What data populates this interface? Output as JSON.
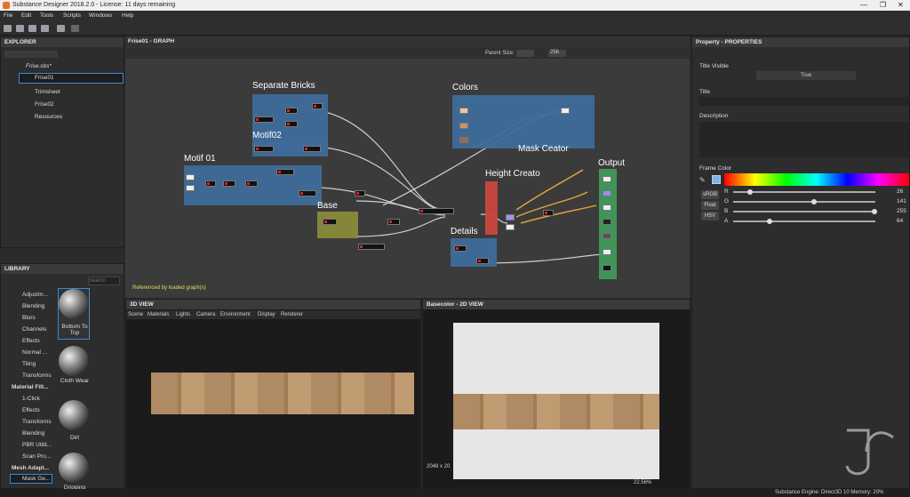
{
  "window": {
    "title": "Substance Designer 2018.2.0 - License: 11 days remaining"
  },
  "menu": [
    "File",
    "Edit",
    "Tools",
    "Scripts",
    "Windows",
    "Help"
  ],
  "explorer": {
    "title": "EXPLORER",
    "package": "Frise.sbs*",
    "items": [
      "Frise01",
      "Trimsheet",
      "Frise02",
      "Resources"
    ]
  },
  "library": {
    "title": "LIBRARY",
    "search_placeholder": "Search",
    "categories": [
      "Adjustm...",
      "Blending",
      "Blurs",
      "Channels",
      "Effects",
      "Normal ...",
      "Tiling",
      "Transforms"
    ],
    "material_header": "Material Filt...",
    "material_items": [
      "1-Click",
      "Effects",
      "Transforms",
      "Blending",
      "PBR Utilit...",
      "Scan Pro..."
    ],
    "mesh_header": "Mesh Adapt...",
    "mesh_items": [
      "Mask Ge..."
    ],
    "thumbs": [
      "Bottom To Top",
      "Cloth Wear",
      "Dirt",
      "Dripping"
    ]
  },
  "graph": {
    "title": "Frise01 - GRAPH",
    "parent_size_label": "Parent Size:",
    "parent_size_value": "256",
    "frames": [
      "Separate Bricks",
      "Motif02",
      "Motif 01",
      "Colors",
      "Mask Ceator",
      "Height Creato",
      "Base",
      "Details",
      "Output"
    ],
    "footer": "Referenced by loaded graph(s)"
  },
  "view3d": {
    "title": "3D VIEW",
    "menu": [
      "Scene",
      "Materials",
      "Lights",
      "Camera",
      "Environment",
      "Display",
      "Renderer"
    ]
  },
  "view2d": {
    "title": "Basecolor - 2D VIEW",
    "resolution": "2048 x 20",
    "zoom": "22.56%"
  },
  "properties": {
    "title": "Property - PROPERTIES",
    "title_visible_label": "Title Visible",
    "title_visible_value": "True",
    "title_label": "Title",
    "description_label": "Description",
    "frame_color_label": "Frame Color",
    "mode_buttons": [
      "sRGB",
      "Float",
      "HSV"
    ],
    "channels": [
      {
        "name": "R",
        "value": 26
      },
      {
        "name": "G",
        "value": 141
      },
      {
        "name": "B",
        "value": 255
      },
      {
        "name": "A",
        "value": 64
      }
    ]
  },
  "status": {
    "engine": "Substance Engine: Direct3D 10  Memory: 20%"
  },
  "colors": {
    "frame_blue": "#3e6b9a",
    "frame_red": "#c9473f",
    "frame_olive": "#8a8a3a",
    "frame_green": "#3f9a58",
    "accent": "#3a8ad9"
  }
}
